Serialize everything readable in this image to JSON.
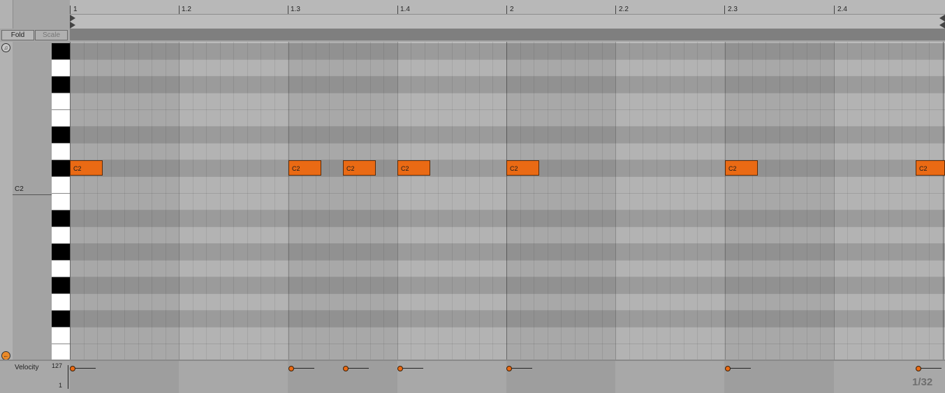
{
  "ruler": {
    "labels": [
      "1",
      "1.2",
      "1.3",
      "1.4",
      "2",
      "2.2",
      "2.3",
      "2.4"
    ]
  },
  "header": {
    "fold_label": "Fold",
    "scale_label": "Scale"
  },
  "keyboard": {
    "c2_label": "C2"
  },
  "notes": [
    {
      "label": "C2",
      "pitch": "C2",
      "start_beat": 1.0,
      "length_beats": 0.125
    },
    {
      "label": "C2",
      "pitch": "C2",
      "start_beat": 1.5,
      "length_beats": 0.125
    },
    {
      "label": "C2",
      "pitch": "C2",
      "start_beat": 1.625,
      "length_beats": 0.125
    },
    {
      "label": "C2",
      "pitch": "C2",
      "start_beat": 1.75,
      "length_beats": 0.125
    },
    {
      "label": "C2",
      "pitch": "C2",
      "start_beat": 2.0,
      "length_beats": 0.125
    },
    {
      "label": "C2",
      "pitch": "C2",
      "start_beat": 2.5,
      "length_beats": 0.125
    },
    {
      "label": "C2",
      "pitch": "C2",
      "start_beat": 2.9375,
      "length_beats": 0.125
    }
  ],
  "velocity": {
    "label": "Velocity",
    "max_label": "127",
    "min_label": "1"
  },
  "grid_quantize": "1/32",
  "colors": {
    "note": "#ea6a14",
    "background": "#a6a6a6"
  }
}
